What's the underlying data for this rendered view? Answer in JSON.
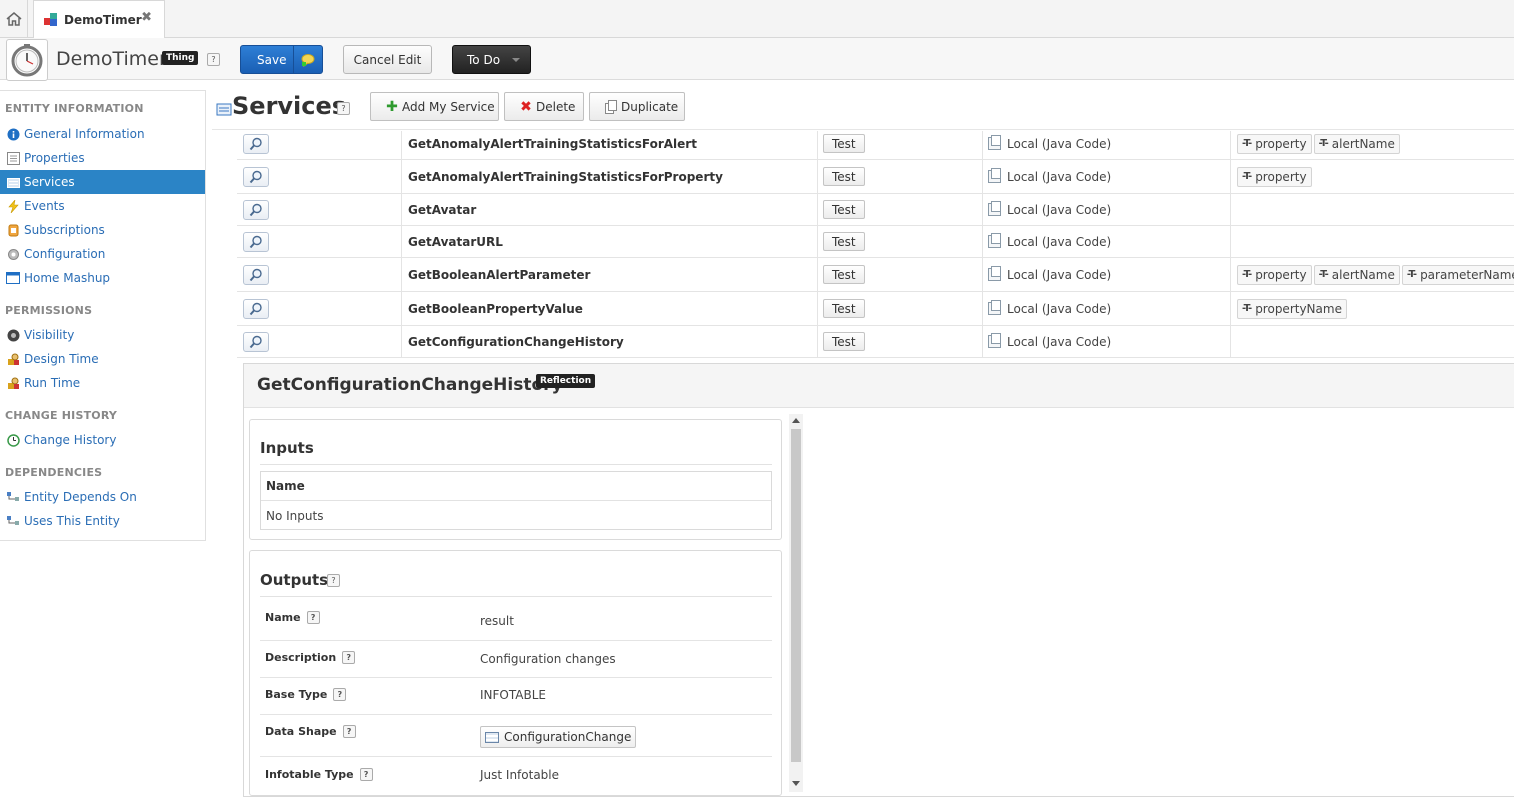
{
  "tabs": {
    "home_icon": "home-icon",
    "active_tab_label": "DemoTimer",
    "close_glyph": "✖"
  },
  "header": {
    "entity_name": "DemoTimer",
    "type_badge": "Thing",
    "help_glyph": "?",
    "save_label": "Save",
    "cancel_label": "Cancel Edit",
    "todo_label": "To Do"
  },
  "sidebar": {
    "sections": [
      {
        "title": "ENTITY INFORMATION",
        "items": [
          {
            "label": "General Information",
            "icon": "info-icon"
          },
          {
            "label": "Properties",
            "icon": "properties-icon"
          },
          {
            "label": "Services",
            "icon": "services-icon",
            "active": true
          },
          {
            "label": "Events",
            "icon": "lightning-icon"
          },
          {
            "label": "Subscriptions",
            "icon": "subscriptions-icon"
          },
          {
            "label": "Configuration",
            "icon": "gear-icon"
          },
          {
            "label": "Home Mashup",
            "icon": "mashup-icon"
          }
        ]
      },
      {
        "title": "PERMISSIONS",
        "items": [
          {
            "label": "Visibility",
            "icon": "visibility-icon"
          },
          {
            "label": "Design Time",
            "icon": "lock-user-icon"
          },
          {
            "label": "Run Time",
            "icon": "lock-user-icon"
          }
        ]
      },
      {
        "title": "CHANGE HISTORY",
        "items": [
          {
            "label": "Change History",
            "icon": "history-icon"
          }
        ]
      },
      {
        "title": "DEPENDENCIES",
        "items": [
          {
            "label": "Entity Depends On",
            "icon": "dependency-icon"
          },
          {
            "label": "Uses This Entity",
            "icon": "dependency-icon"
          }
        ]
      }
    ]
  },
  "main": {
    "title": "Services",
    "add_label": "Add My Service",
    "delete_label": "Delete",
    "duplicate_label": "Duplicate"
  },
  "services": [
    {
      "name": "GetAnomalyAlertTrainingStatisticsForAlert",
      "test": "Test",
      "source": "Local (Java Code)",
      "params": [
        "property",
        "alertName"
      ]
    },
    {
      "name": "GetAnomalyAlertTrainingStatisticsForProperty",
      "test": "Test",
      "source": "Local (Java Code)",
      "params": [
        "property"
      ]
    },
    {
      "name": "GetAvatar",
      "test": "Test",
      "source": "Local (Java Code)",
      "params": []
    },
    {
      "name": "GetAvatarURL",
      "test": "Test",
      "source": "Local (Java Code)",
      "params": []
    },
    {
      "name": "GetBooleanAlertParameter",
      "test": "Test",
      "source": "Local (Java Code)",
      "params": [
        "property",
        "alertName",
        "parameterName"
      ]
    },
    {
      "name": "GetBooleanPropertyValue",
      "test": "Test",
      "source": "Local (Java Code)",
      "params": [
        "propertyName"
      ]
    },
    {
      "name": "GetConfigurationChangeHistory",
      "test": "Test",
      "source": "Local (Java Code)",
      "params": []
    }
  ],
  "detail": {
    "title": "GetConfigurationChangeHistory",
    "badge": "Reflection",
    "inputs_title": "Inputs",
    "inputs_header": "Name",
    "inputs_empty": "No Inputs",
    "outputs_title": "Outputs",
    "outputs": [
      {
        "label": "Name",
        "value": "result"
      },
      {
        "label": "Description",
        "value": "Configuration changes"
      },
      {
        "label": "Base Type",
        "value": "INFOTABLE"
      },
      {
        "label": "Data Shape",
        "value": "ConfigurationChange"
      },
      {
        "label": "Infotable Type",
        "value": "Just Infotable"
      }
    ]
  },
  "colors": {
    "accent": "#2b84c6",
    "save": "#1a5fb4",
    "link": "#2a6db5"
  }
}
